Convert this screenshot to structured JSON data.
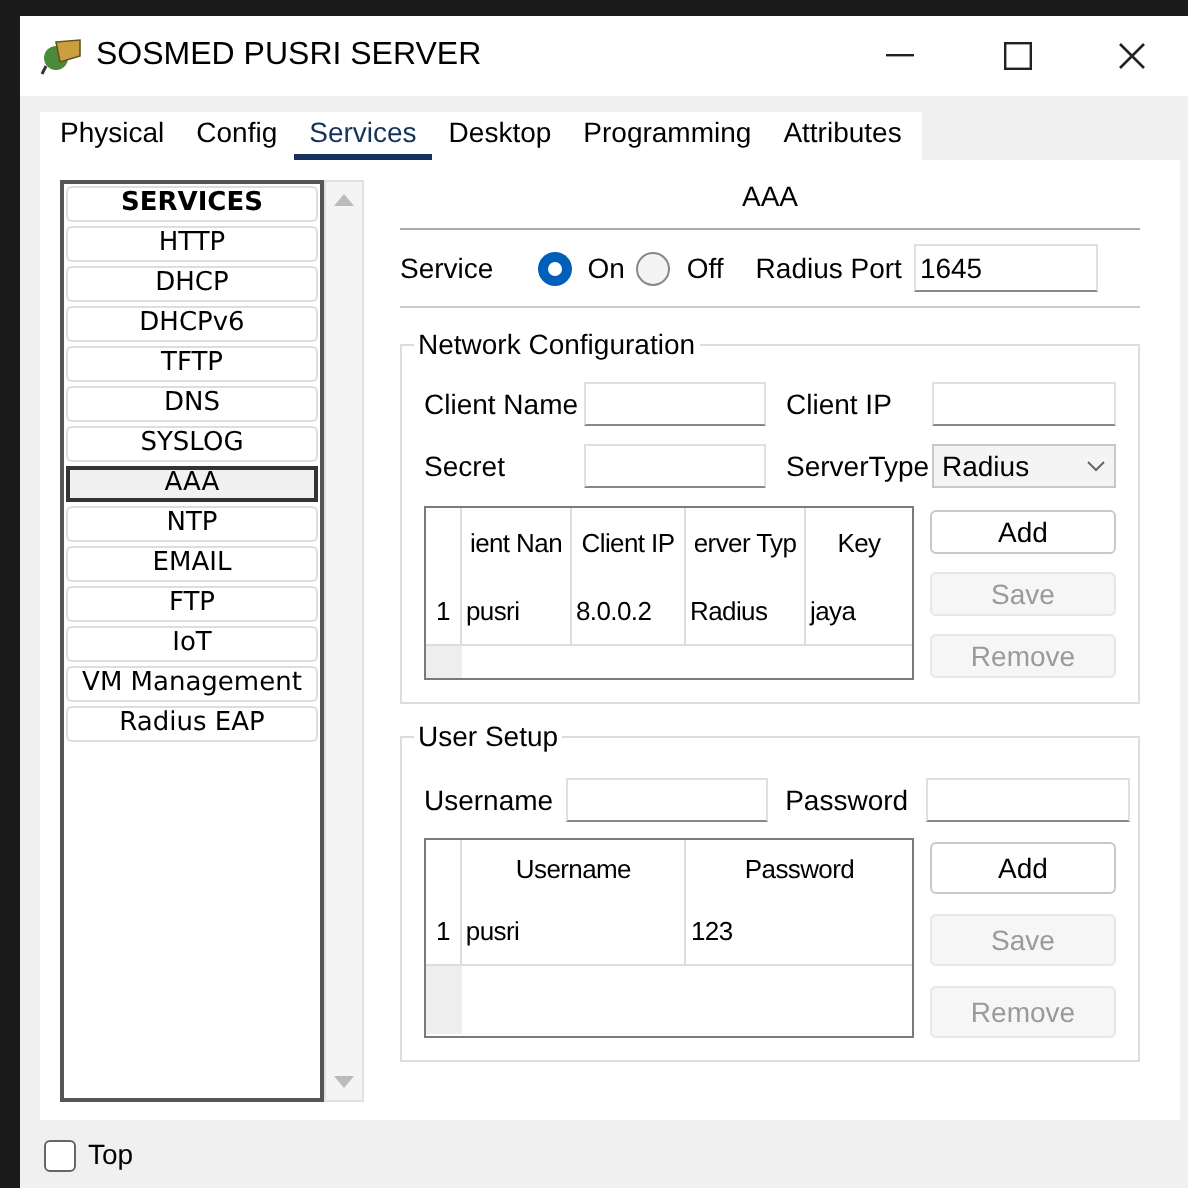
{
  "window": {
    "title": "SOSMED PUSRI SERVER"
  },
  "tabs": [
    {
      "label": "Physical",
      "selected": false
    },
    {
      "label": "Config",
      "selected": false
    },
    {
      "label": "Services",
      "selected": true
    },
    {
      "label": "Desktop",
      "selected": false
    },
    {
      "label": "Programming",
      "selected": false
    },
    {
      "label": "Attributes",
      "selected": false
    }
  ],
  "services": {
    "heading": "SERVICES",
    "items": [
      {
        "label": "HTTP",
        "selected": false
      },
      {
        "label": "DHCP",
        "selected": false
      },
      {
        "label": "DHCPv6",
        "selected": false
      },
      {
        "label": "TFTP",
        "selected": false
      },
      {
        "label": "DNS",
        "selected": false
      },
      {
        "label": "SYSLOG",
        "selected": false
      },
      {
        "label": "AAA",
        "selected": true
      },
      {
        "label": "NTP",
        "selected": false
      },
      {
        "label": "EMAIL",
        "selected": false
      },
      {
        "label": "FTP",
        "selected": false
      },
      {
        "label": "IoT",
        "selected": false
      },
      {
        "label": "VM Management",
        "selected": false
      },
      {
        "label": "Radius EAP",
        "selected": false
      }
    ]
  },
  "panel": {
    "title": "AAA",
    "service_label": "Service",
    "radios": [
      {
        "label": "On",
        "selected": true
      },
      {
        "label": "Off",
        "selected": false
      }
    ],
    "port_label": "Radius Port",
    "port_value": "1645",
    "network": {
      "legend": "Network Configuration",
      "fields": [
        {
          "label": "Client Name",
          "kind": "text"
        },
        {
          "label": "Client IP",
          "kind": "text"
        },
        {
          "label": "Secret",
          "kind": "text"
        },
        {
          "label": "ServerType",
          "kind": "select",
          "value": "Radius"
        }
      ],
      "table": {
        "columns": [
          "ient Nan",
          "Client IP",
          "erver Typ",
          "Key"
        ],
        "rows": [
          {
            "index": "1",
            "cells": [
              "pusri",
              "8.0.0.2",
              "Radius",
              "jaya"
            ]
          }
        ]
      },
      "buttons": [
        {
          "label": "Add",
          "disabled": false
        },
        {
          "label": "Save",
          "disabled": true
        },
        {
          "label": "Remove",
          "disabled": true
        }
      ]
    },
    "users": {
      "legend": "User Setup",
      "fields": [
        {
          "label": "Username",
          "kind": "text"
        },
        {
          "label": "Password",
          "kind": "text"
        }
      ],
      "table": {
        "columns": [
          "Username",
          "Password"
        ],
        "rows": [
          {
            "index": "1",
            "cells": [
              "pusri",
              "123"
            ]
          }
        ]
      },
      "buttons": [
        {
          "label": "Add",
          "disabled": false
        },
        {
          "label": "Save",
          "disabled": true
        },
        {
          "label": "Remove",
          "disabled": true
        }
      ]
    }
  },
  "top_checkbox": {
    "label": "Top",
    "checked": false
  }
}
